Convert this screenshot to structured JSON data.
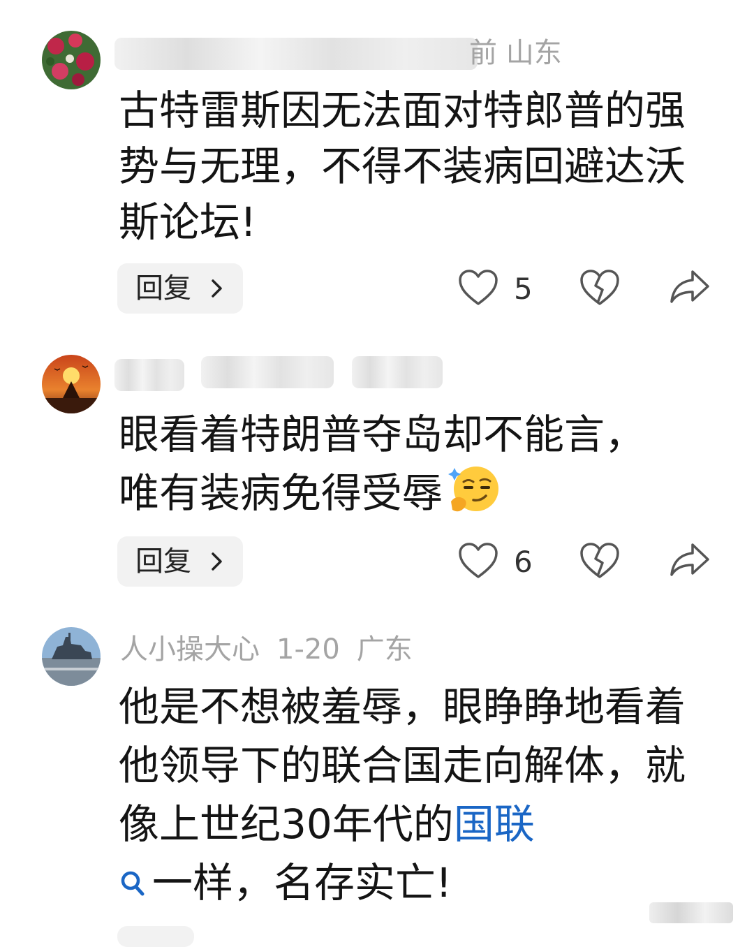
{
  "comments": [
    {
      "meta_visible": "前  山东",
      "text": "古特雷斯因无法面对特郎普的强势与无理，不得不装病回避达沃斯论坛!",
      "reply_label": "回复",
      "likes": "5"
    },
    {
      "text": "眼看着特朗普夺岛却不能言，唯有装病免得受辱",
      "reply_label": "回复",
      "likes": "6"
    },
    {
      "username": "人小操大心",
      "date": "1-20",
      "location": "广东",
      "text_before_link": "他是不想被羞辱，眼睁睁地看着他领导下的联合国走向解体，就像上世纪30年代的",
      "link_text": "国联",
      "text_after_link": "一样，名存实亡!"
    }
  ],
  "colors": {
    "link": "#1a66c5",
    "meta": "#a4a4a4",
    "body": "#141414",
    "reply_bg": "#f2f2f2"
  },
  "icons": [
    "heart-icon",
    "broken-heart-icon",
    "share-icon",
    "chevron-right-icon",
    "search-icon",
    "smirk-emoji"
  ]
}
